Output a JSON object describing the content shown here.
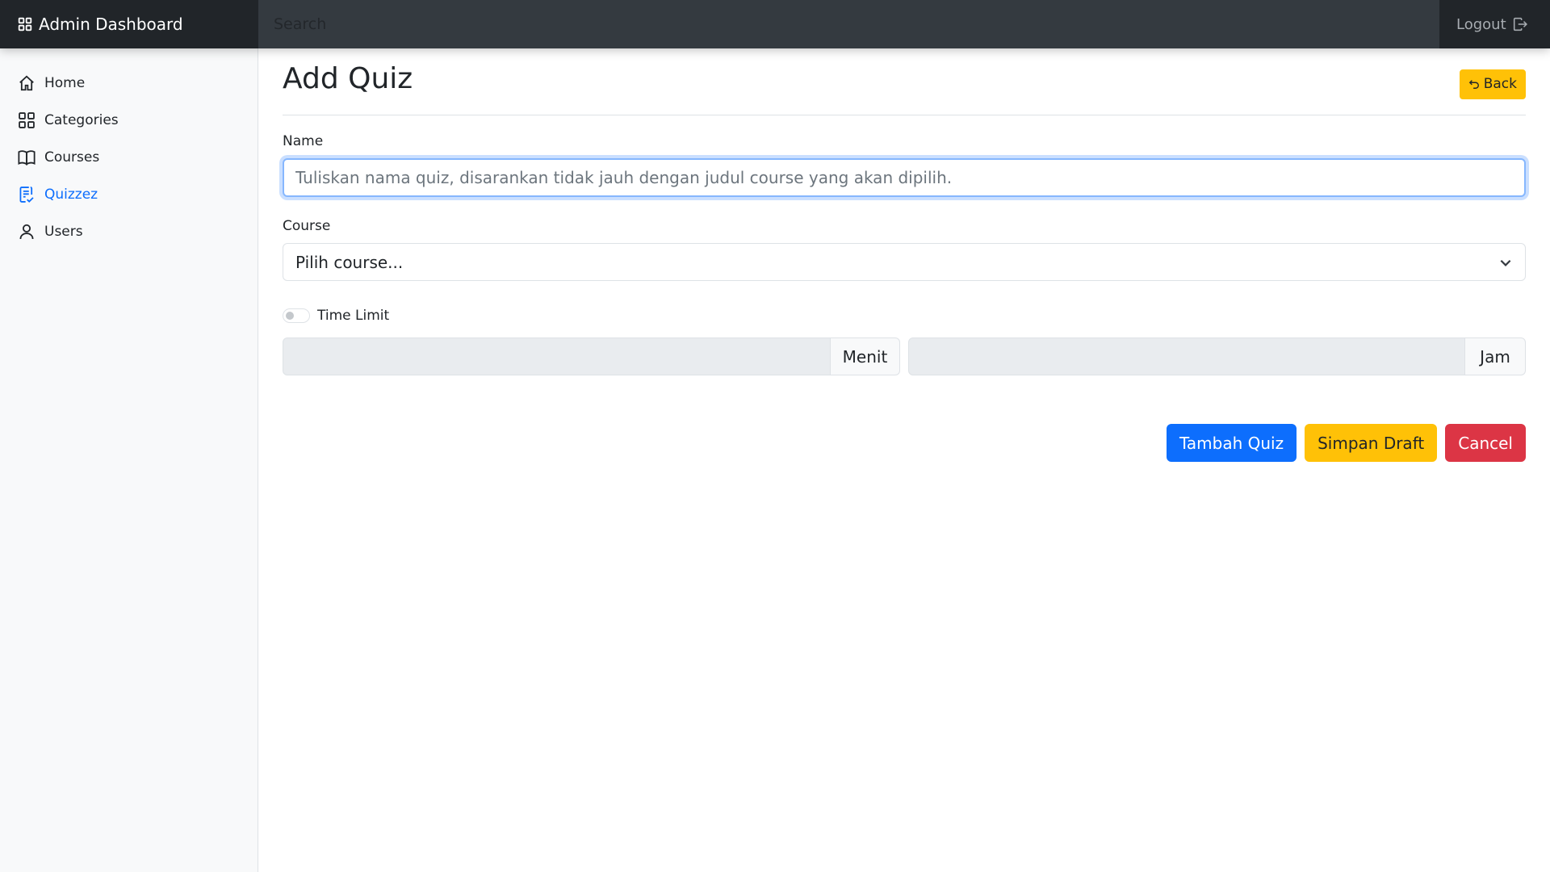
{
  "navbar": {
    "brand_icon": "grid-icon",
    "brand": "Admin Dashboard",
    "search_placeholder": "Search",
    "logout_label": "Logout",
    "logout_icon": "logout-icon"
  },
  "sidebar": {
    "items": [
      {
        "label": "Home",
        "icon": "house-icon",
        "active": false
      },
      {
        "label": "Categories",
        "icon": "grid-icon",
        "active": false
      },
      {
        "label": "Courses",
        "icon": "book-icon",
        "active": false
      },
      {
        "label": "Quizzez",
        "icon": "clipboard-check-icon",
        "active": true
      },
      {
        "label": "Users",
        "icon": "person-icon",
        "active": false
      }
    ]
  },
  "main": {
    "title": "Add Quiz",
    "back_label": "Back",
    "back_icon": "return-arrow-icon",
    "name_label": "Name",
    "name_placeholder": "Tuliskan nama quiz, disarankan tidak jauh dengan judul course yang akan dipilih.",
    "name_value": "",
    "course_label": "Course",
    "course_selected": "Pilih course...",
    "time_limit_label": "Time Limit",
    "time_limit_enabled": false,
    "minutes_value": "",
    "minutes_unit": "Menit",
    "hours_value": "",
    "hours_unit": "Jam",
    "submit_label": "Tambah Quiz",
    "draft_label": "Simpan Draft",
    "cancel_label": "Cancel"
  },
  "colors": {
    "primary": "#0d6efd",
    "warning": "#ffc107",
    "danger": "#dc3545",
    "navbar": "#343a40",
    "navbar_dark": "#212529"
  }
}
